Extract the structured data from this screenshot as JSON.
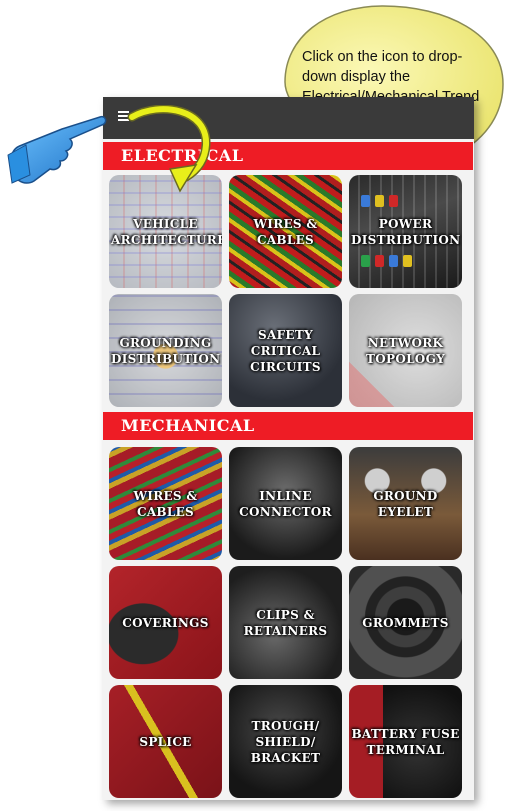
{
  "callout": {
    "text": "Click on the icon to drop-down display the Electrical/Mechanical Trend Key shortcut image-icons."
  },
  "menu": {
    "icon": "hamburger-menu-icon"
  },
  "sections": {
    "electrical": {
      "title": "ELECTRICAL",
      "tiles": [
        {
          "label": "VEHICLE\nARCHITECTURE"
        },
        {
          "label": "WIRES &\nCABLES"
        },
        {
          "label": "POWER\nDISTRIBUTION"
        },
        {
          "label": "GROUNDING\nDISTRIBUTION"
        },
        {
          "label": "SAFETY\nCRITICAL\nCIRCUITS"
        },
        {
          "label": "NETWORK\nTOPOLOGY"
        }
      ]
    },
    "mechanical": {
      "title": "MECHANICAL",
      "tiles": [
        {
          "label": "WIRES &\nCABLES"
        },
        {
          "label": "INLINE\nCONNECTOR"
        },
        {
          "label": "GROUND\nEYELET"
        },
        {
          "label": "COVERINGS"
        },
        {
          "label": "CLIPS &\nRETAINERS"
        },
        {
          "label": "GROMMETS"
        },
        {
          "label": "SPLICE"
        },
        {
          "label": "TROUGH/\nSHIELD/\nBRACKET"
        },
        {
          "label": "BATTERY FUSE\nTERMINAL"
        }
      ]
    }
  },
  "colors": {
    "section_red": "#ee1c25",
    "topbar": "#3a3a3a",
    "bubble_fill": "#f5f08a",
    "arrow_yellow": "#e8ef1a",
    "hand_blue": "#2a8fe0"
  }
}
